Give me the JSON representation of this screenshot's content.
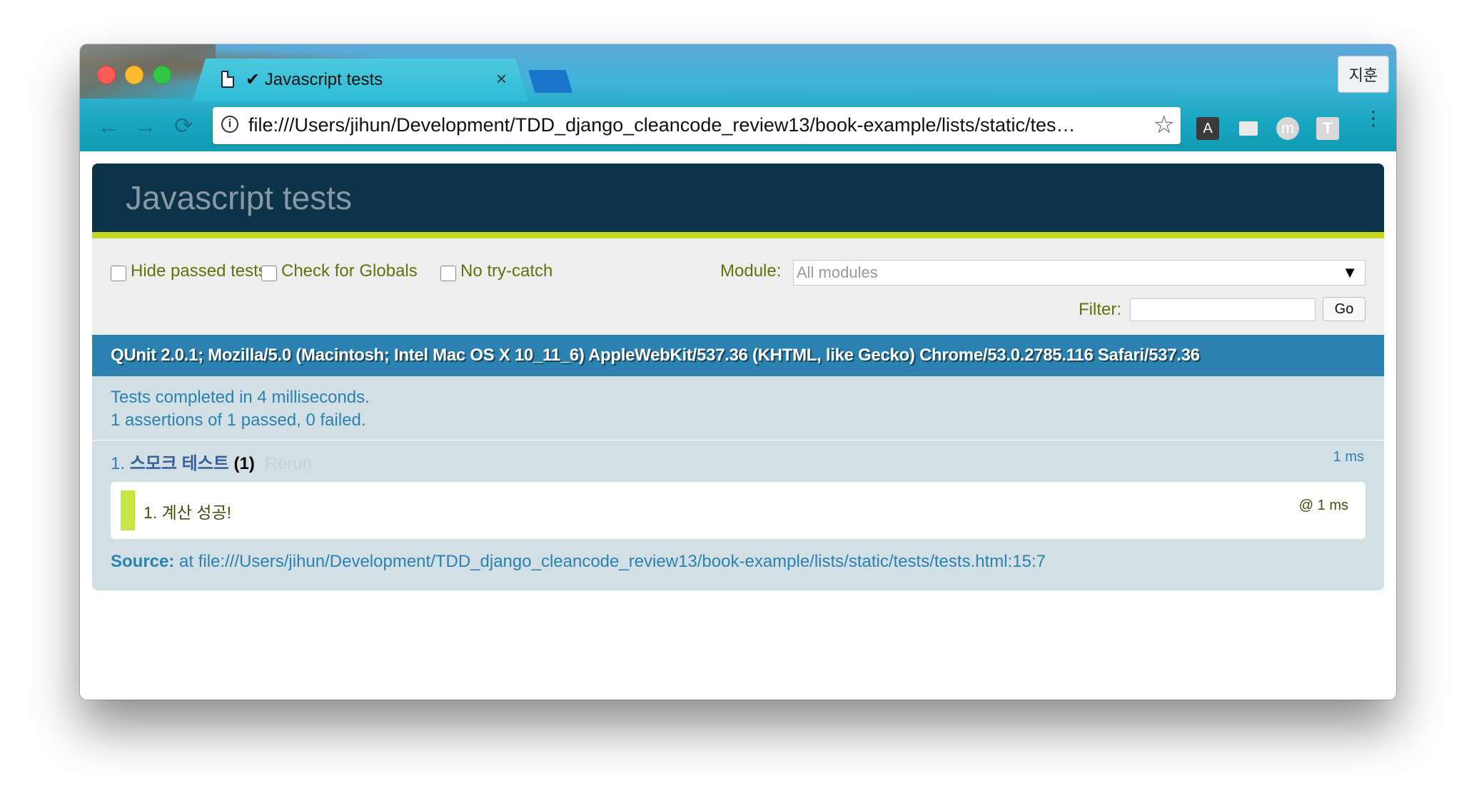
{
  "window": {
    "tab": {
      "title": "✔ Javascript tests",
      "close": "×"
    },
    "profile_label": "지훈",
    "address_bar": {
      "url": "file:///Users/jihun/Development/TDD_django_cleancode_review13/book-example/lists/static/tes…",
      "info_glyph": "i",
      "star_glyph": "☆"
    },
    "extensions": {
      "a": "A",
      "m": "m",
      "t": "T"
    },
    "nav": {
      "back": "←",
      "forward": "→",
      "reload": "⟳",
      "menu": "⋮"
    }
  },
  "qunit": {
    "header": "Javascript tests",
    "toolbar": {
      "hide_passed": "Hide passed tests",
      "check_globals": "Check for Globals",
      "no_try_catch": "No try-catch",
      "module_label": "Module:",
      "module_value": "All modules",
      "filter_label": "Filter:",
      "go_label": "Go"
    },
    "user_agent": "QUnit 2.0.1; Mozilla/5.0 (Macintosh; Intel Mac OS X 10_11_6) AppleWebKit/537.36 (KHTML, like Gecko) Chrome/53.0.2785.116 Safari/537.36",
    "result_line1": "Tests completed in 4 milliseconds.",
    "result_line2": "1 assertions of 1 passed, 0 failed.",
    "test": {
      "index": "1. ",
      "name": "스모크 테스트",
      "counts": "(1)",
      "rerun": "Rerun",
      "runtime": "1 ms",
      "assertion": {
        "message": "1. 계산 성공!",
        "runtime": "@ 1 ms"
      },
      "source_label": "Source:",
      "source_text": "at file:///Users/jihun/Development/TDD_django_cleancode_review13/book-example/lists/static/tests/tests.html:15:7"
    }
  },
  "colors": {
    "qunit_header_bg": "#0d3349",
    "qunit_header_accent": "#c2d721",
    "user_agent_bg": "#2b81af",
    "result_bg": "#d2e0e6",
    "pass_marker": "#c6e746"
  }
}
